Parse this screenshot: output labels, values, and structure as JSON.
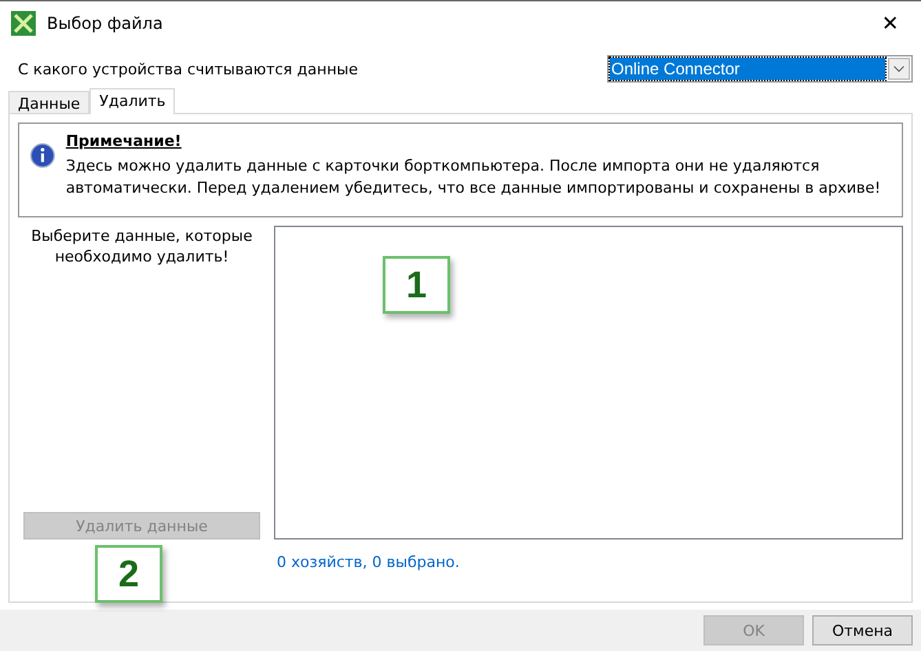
{
  "window": {
    "title": "Выбор файла",
    "close": "✕"
  },
  "device": {
    "label": "С какого устройства считываются данные",
    "value": "Online Connector"
  },
  "tabs": [
    {
      "label": "Данные",
      "selected": false
    },
    {
      "label": "Удалить",
      "selected": true
    }
  ],
  "note": {
    "title": "Примечание!",
    "text": "Здесь можно удалить данные с карточки борткомпьютера. После импорта они не удаляются автоматически. Перед удалением убедитесь, что все данные импортированы и сохранены в архиве!"
  },
  "prompt": "Выберите данные, которые необходимо удалить!",
  "delete_button": {
    "label": "Удалить данные",
    "disabled": true
  },
  "status": "0 хозяйств, 0 выбрано.",
  "callouts": [
    "1",
    "2"
  ],
  "buttons": [
    {
      "label": "OK",
      "disabled": true
    },
    {
      "label": "Отмена",
      "disabled": false
    }
  ]
}
